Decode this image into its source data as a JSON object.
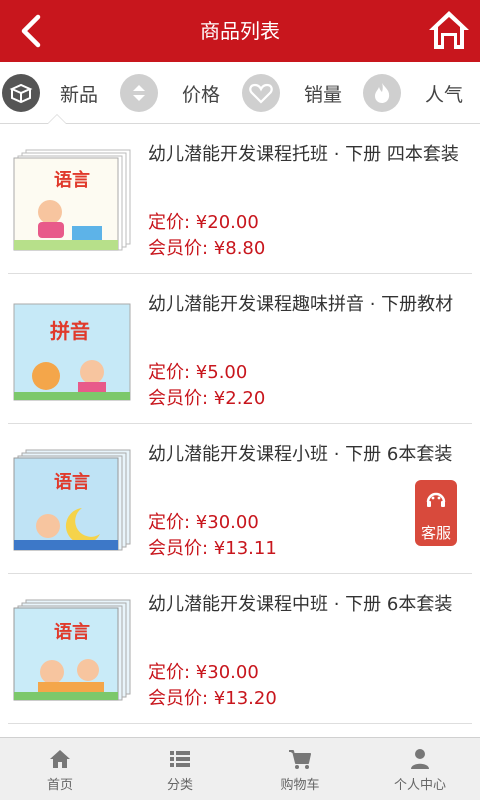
{
  "header": {
    "title": "商品列表"
  },
  "sort": {
    "items": [
      {
        "label": "新品",
        "icon": "box-icon"
      },
      {
        "label": "价格",
        "icon": "sort-arrows-icon"
      },
      {
        "label": "销量",
        "icon": "heart-icon"
      },
      {
        "label": "人气",
        "icon": "flame-icon"
      }
    ]
  },
  "products": [
    {
      "name": "幼儿潜能开发课程托班 · 下册 四本套装",
      "price": "定价: ¥20.00",
      "member_price": "会员价: ¥8.80",
      "cover_text": "语言"
    },
    {
      "name": "幼儿潜能开发课程趣味拼音 · 下册教材",
      "price": "定价: ¥5.00",
      "member_price": "会员价: ¥2.20",
      "cover_text": "拼音"
    },
    {
      "name": "幼儿潜能开发课程小班 · 下册 6本套装",
      "price": "定价: ¥30.00",
      "member_price": "会员价: ¥13.11",
      "cover_text": "语言"
    },
    {
      "name": "幼儿潜能开发课程中班 · 下册 6本套装",
      "price": "定价: ¥30.00",
      "member_price": "会员价: ¥13.20",
      "cover_text": "语言"
    }
  ],
  "service": {
    "label": "客服"
  },
  "nav": {
    "items": [
      {
        "label": "首页",
        "icon": "home-icon"
      },
      {
        "label": "分类",
        "icon": "list-icon"
      },
      {
        "label": "购物车",
        "icon": "cart-icon"
      },
      {
        "label": "个人中心",
        "icon": "user-icon"
      }
    ]
  },
  "colors": {
    "brand": "#c8161d",
    "price": "#c8161d",
    "service": "#d84a3c"
  }
}
